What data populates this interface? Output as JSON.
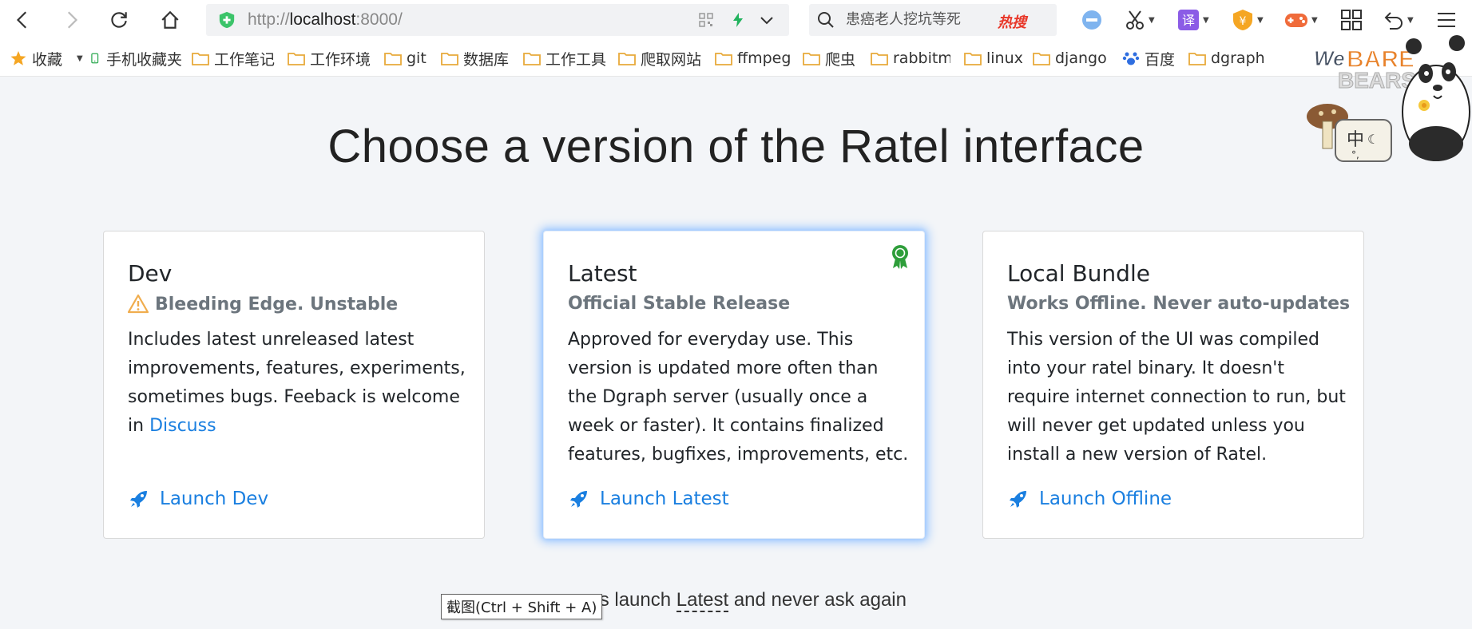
{
  "browser": {
    "url_prefix": "http://",
    "url_host": "localhost",
    "url_suffix": ":8000/",
    "search_text": "患癌老人挖坑等死",
    "hot_badge": "热搜"
  },
  "bookmarks": [
    {
      "label": "收藏",
      "icon": "star-icon"
    },
    {
      "label": "手机收藏夹",
      "icon": "phone-icon"
    },
    {
      "label": "工作笔记",
      "icon": "folder-icon"
    },
    {
      "label": "工作环境",
      "icon": "folder-icon"
    },
    {
      "label": "git",
      "icon": "folder-icon"
    },
    {
      "label": "数据库",
      "icon": "folder-icon"
    },
    {
      "label": "工作工具",
      "icon": "folder-icon"
    },
    {
      "label": "爬取网站",
      "icon": "folder-icon"
    },
    {
      "label": "ffmpeg",
      "icon": "folder-icon"
    },
    {
      "label": "爬虫",
      "icon": "folder-icon"
    },
    {
      "label": "rabbitm",
      "icon": "folder-icon"
    },
    {
      "label": "linux",
      "icon": "folder-icon"
    },
    {
      "label": "django",
      "icon": "folder-icon"
    },
    {
      "label": "百度",
      "icon": "paw-icon"
    },
    {
      "label": "dgraph",
      "icon": "folder-icon"
    }
  ],
  "page": {
    "title": "Choose a version of the Ratel interface",
    "footer_before": "ways launch ",
    "footer_link": "Latest",
    "footer_after": " and never ask again",
    "tooltip": "截图(Ctrl + Shift + A)"
  },
  "cards": [
    {
      "title": "Dev",
      "subtitle": "Bleeding Edge. Unstable",
      "body": "Includes latest unreleased latest improvements, features, experiments, sometimes bugs. Feeback is welcome in ",
      "body_link": "Discuss",
      "launch": "Launch Dev"
    },
    {
      "title": "Latest",
      "subtitle": "Official Stable Release",
      "body": "Approved for everyday use. This version is updated more often than the Dgraph server (usually once a week or faster). It contains finalized features, bugfixes, improvements, etc.",
      "launch": "Launch Latest"
    },
    {
      "title": "Local Bundle",
      "subtitle": "Works Offline. Never auto-updates",
      "body": "This version of the UI was compiled into your ratel binary. It doesn't require internet connection to run, but will never get updated unless you install a new version of Ratel.",
      "launch": "Launch Offline"
    }
  ],
  "colors": {
    "link": "#1a7fe0",
    "warning": "#f0ad4e",
    "ribbon": "#2e9e3a",
    "page_bg": "#f3f5f8"
  }
}
